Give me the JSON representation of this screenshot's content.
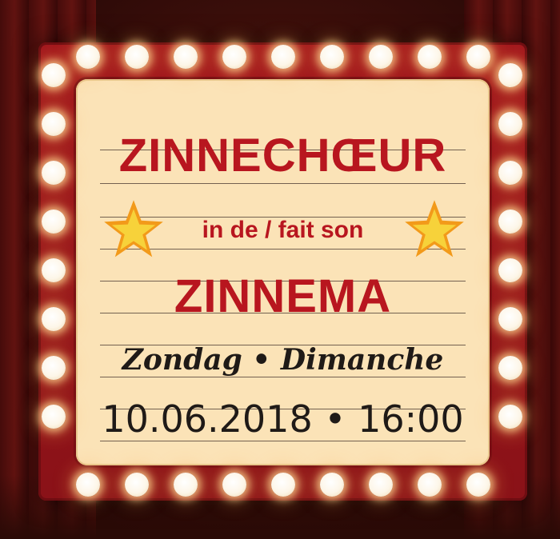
{
  "poster": {
    "title": "ZINNECHŒUR",
    "connector": "in de / fait son",
    "venue": "ZINNEMA",
    "day": "Zondag • Dimanche",
    "datetime": "10.06.2018 • 16:00"
  },
  "colors": {
    "frame": "#a2171d",
    "panel": "#fbe3b7",
    "title_red": "#b8161f",
    "text_dark": "#1f1a17",
    "star_yellow": "#f7c21a"
  },
  "icons": [
    "star-icon-left",
    "star-icon-right",
    "marquee-bulb"
  ]
}
